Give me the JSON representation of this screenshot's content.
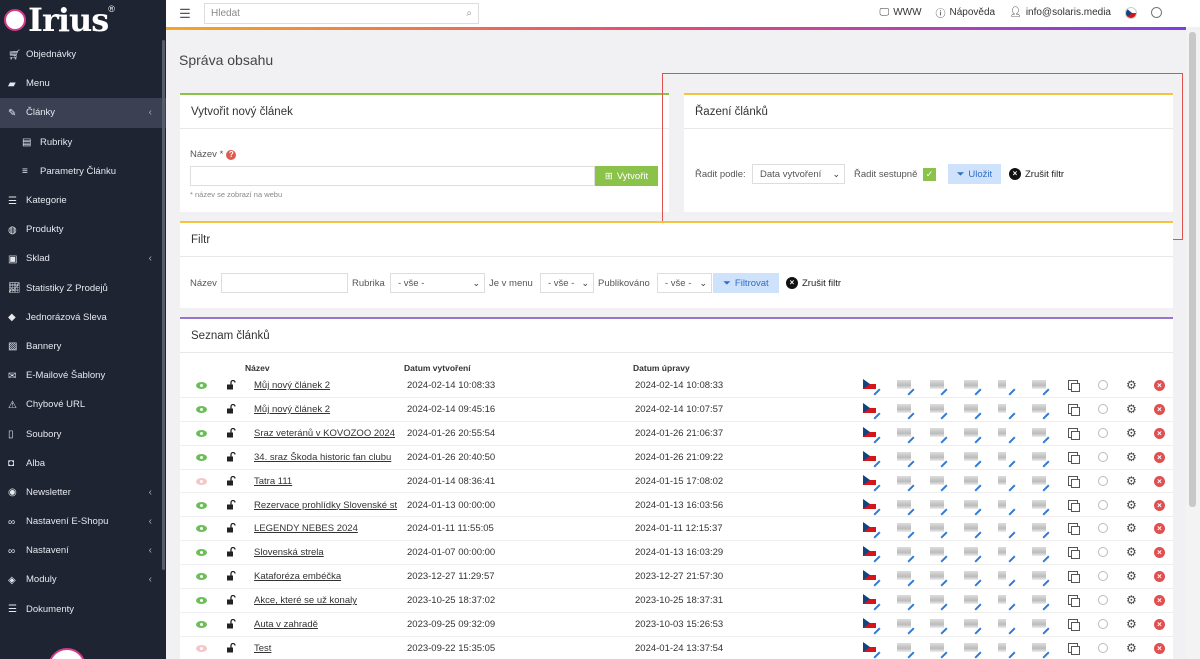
{
  "app": {
    "logo_text": "Irius",
    "logo_reg": "®"
  },
  "sidebar": {
    "items": [
      {
        "label": "Objednávky",
        "icon": "cart-icon",
        "chevron": false
      },
      {
        "label": "Menu",
        "icon": "folder-icon",
        "chevron": false
      },
      {
        "label": "Články",
        "icon": "pencil-icon",
        "chevron": true,
        "active": true
      },
      {
        "label": "Rubriky",
        "icon": "book-icon",
        "chevron": false,
        "sub": true
      },
      {
        "label": "Parametry Článku",
        "icon": "sliders-icon",
        "chevron": false,
        "sub": true
      },
      {
        "label": "Kategorie",
        "icon": "list-icon",
        "chevron": false
      },
      {
        "label": "Produkty",
        "icon": "globe-icon",
        "chevron": false
      },
      {
        "label": "Sklad",
        "icon": "box-icon",
        "chevron": true
      },
      {
        "label": "Statistiky Z Prodejů",
        "icon": "chart-icon",
        "chevron": false
      },
      {
        "label": "Jednorázová Sleva",
        "icon": "tag-icon",
        "chevron": false
      },
      {
        "label": "Bannery",
        "icon": "image-icon",
        "chevron": false
      },
      {
        "label": "E-Mailové Šablony",
        "icon": "mail-icon",
        "chevron": false
      },
      {
        "label": "Chybové URL",
        "icon": "warning-icon",
        "chevron": false
      },
      {
        "label": "Soubory",
        "icon": "file-icon",
        "chevron": false
      },
      {
        "label": "Alba",
        "icon": "camera-icon",
        "chevron": false
      },
      {
        "label": "Newsletter",
        "icon": "at-icon",
        "chevron": true
      },
      {
        "label": "Nastavení E-Shopu",
        "icon": "link-icon",
        "chevron": true
      },
      {
        "label": "Nastavení",
        "icon": "link-icon",
        "chevron": true
      },
      {
        "label": "Moduly",
        "icon": "cube-icon",
        "chevron": true
      },
      {
        "label": "Dokumenty",
        "icon": "list-icon",
        "chevron": false
      }
    ]
  },
  "topbar": {
    "search_placeholder": "Hledat",
    "www": "WWW",
    "help": "Nápověda",
    "user": "info@solaris.media"
  },
  "page": {
    "title": "Správa obsahu"
  },
  "create": {
    "title": "Vytvořit nový článek",
    "name_label": "Název *",
    "button": "Vytvořit",
    "hint": "* název se zobrazí na webu"
  },
  "sorting": {
    "title": "Řazení článků",
    "sort_by_label": "Řadit podle:",
    "sort_by_value": "Data vytvoření",
    "desc_label": "Řadit sestupně",
    "save": "Uložit",
    "cancel": "Zrušit filtr"
  },
  "filter": {
    "title": "Filtr",
    "name_label": "Název",
    "category_label": "Rubrika",
    "category_value": "- vše -",
    "menu_label": "Je v menu",
    "menu_value": "- vše -",
    "published_label": "Publikováno",
    "published_value": "- vše -",
    "apply": "Filtrovat",
    "cancel": "Zrušit filtr"
  },
  "list": {
    "title": "Seznam článků",
    "columns": {
      "name": "Název",
      "created": "Datum vytvoření",
      "updated": "Datum úpravy"
    },
    "rows": [
      {
        "visible": true,
        "name": "Můj nový článek 2",
        "created": "2024-02-14 10:08:33",
        "updated": "2024-02-14 10:08:33"
      },
      {
        "visible": true,
        "name": "Můj nový článek 2",
        "created": "2024-02-14 09:45:16",
        "updated": "2024-02-14 10:07:57"
      },
      {
        "visible": true,
        "name": "Sraz veteránů v KOVOZOO 2024",
        "created": "2024-01-26 20:55:54",
        "updated": "2024-01-26 21:06:37"
      },
      {
        "visible": true,
        "name": "34. sraz Škoda historic fan clubu",
        "created": "2024-01-26 20:40:50",
        "updated": "2024-01-26 21:09:22"
      },
      {
        "visible": false,
        "name": "Tatra 111",
        "created": "2024-01-14 08:36:41",
        "updated": "2024-01-15 17:08:02"
      },
      {
        "visible": true,
        "name": "Rezervace prohlídky Slovenské st",
        "created": "2024-01-13 00:00:00",
        "updated": "2024-01-13 16:03:56"
      },
      {
        "visible": true,
        "name": "LEGENDY NEBES 2024",
        "created": "2024-01-11 11:55:05",
        "updated": "2024-01-11 12:15:37"
      },
      {
        "visible": true,
        "name": "Slovenská strela",
        "created": "2024-01-07 00:00:00",
        "updated": "2024-01-13 16:03:29"
      },
      {
        "visible": true,
        "name": "Kataforéza embéčka",
        "created": "2023-12-27 11:29:57",
        "updated": "2023-12-27 21:57:30"
      },
      {
        "visible": true,
        "name": "Akce, které se už konaly",
        "created": "2023-10-25 18:37:02",
        "updated": "2023-10-25 18:37:31"
      },
      {
        "visible": true,
        "name": "Auta v zahradě",
        "created": "2023-09-25 09:32:09",
        "updated": "2023-10-03 15:26:53"
      },
      {
        "visible": false,
        "name": "Test",
        "created": "2023-09-22 15:35:05",
        "updated": "2024-01-24 13:37:54"
      }
    ]
  },
  "colors": {
    "sidebar": "#1f2433",
    "accent_green": "#8bc34a",
    "accent_blue": "#cfe2fb",
    "highlight": "#e0524f"
  }
}
